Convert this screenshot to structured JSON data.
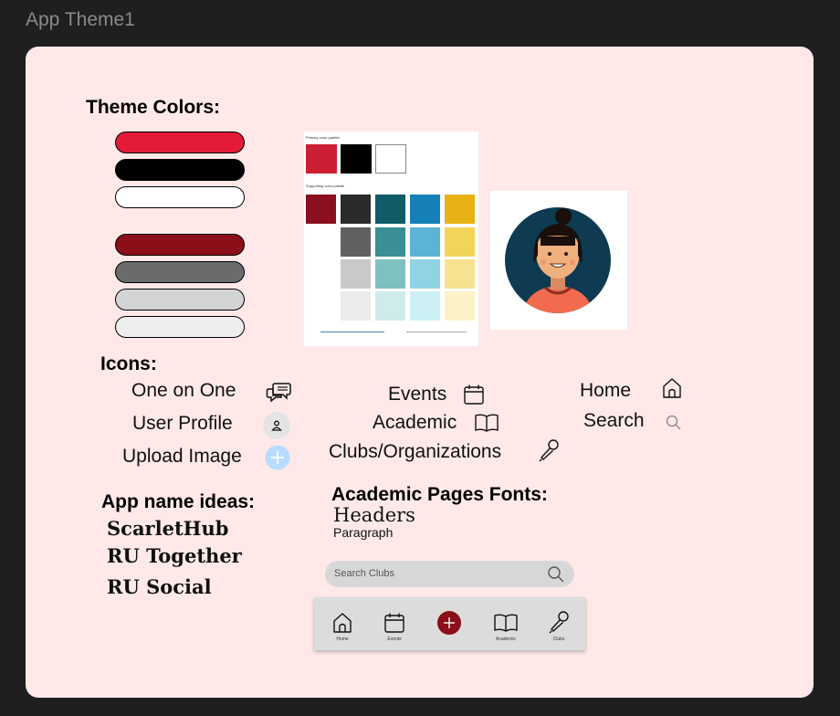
{
  "frame": {
    "title": "App Theme1"
  },
  "theme": {
    "heading": "Theme Colors:",
    "swatches": [
      "#e31b37",
      "#000000",
      "#ffffff",
      "#8b0f18",
      "#6b6b6b",
      "#d4d4d4",
      "#eeeeee"
    ]
  },
  "palette": {
    "primary_heading": "Primary color palette",
    "supporting_heading": "Supporting color palette",
    "primary": [
      "#cc1f31",
      "#000000",
      "#ffffff"
    ],
    "supporting_colors": [
      "#8a1020",
      "#2b2b2b",
      "#0f5c68",
      "#1681b6",
      "#e8b214",
      "#616161",
      "#3a8f94",
      "#5db3d4",
      "#f4d35a",
      "#c9c9c9",
      "#7fc0c0",
      "#8fd3e5",
      "#f8e291",
      "#ececec",
      "#cfeceb",
      "#cdeff6",
      "#fdf2c7"
    ]
  },
  "icons_section": {
    "heading": "Icons:",
    "items": {
      "one_on_one": "One on One",
      "user_profile": "User Profile",
      "upload_image": "Upload Image",
      "events": "Events",
      "academic": "Academic",
      "clubs": "Clubs/Organizations",
      "home": "Home",
      "search": "Search"
    }
  },
  "app_names": {
    "heading": "App name ideas:",
    "ideas": [
      "ScarletHub",
      "RU Together",
      "RU Social"
    ]
  },
  "fonts": {
    "heading": "Academic Pages Fonts:",
    "headers_sample": "Headers",
    "paragraph_sample": "Paragraph"
  },
  "search": {
    "placeholder": "Search Clubs"
  },
  "nav": {
    "items": [
      "Home",
      "Events",
      "Academic",
      "Clubs"
    ]
  },
  "colors": {
    "board_bg": "#ffe9e8",
    "accent": "#8b0f18",
    "upload_blue": "#b7dcff",
    "avatar_bg": "#0e3a52"
  }
}
